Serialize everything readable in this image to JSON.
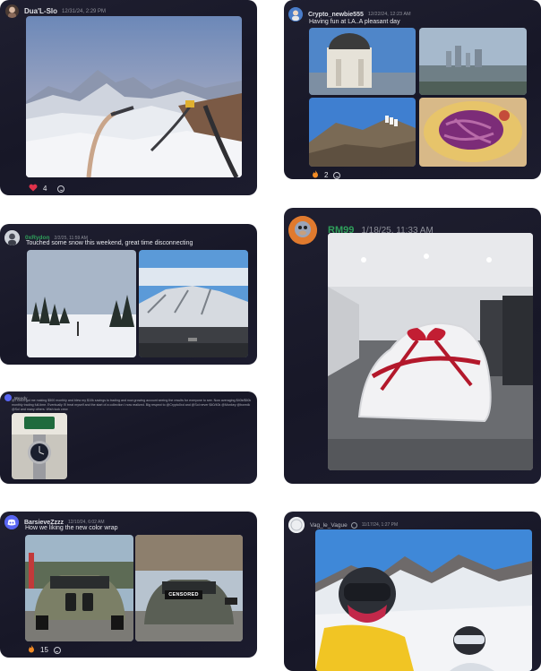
{
  "posts": [
    {
      "username": "Dua'L-Slo",
      "timestamp": "12/31/24, 2:29 PM",
      "heart_count": "4"
    },
    {
      "username": "Crypto_newbie555",
      "timestamp": "12/22/24, 12:23 AM",
      "message": "Having fun at LA..A pleasant day",
      "reaction_count": "2"
    },
    {
      "username": "0xRydon",
      "timestamp": "2/2/25, 11:59 AM",
      "message": "Touched some snow this weekend, great time disconnecting"
    },
    {
      "username": "RM99",
      "timestamp": "1/18/25, 11:33 AM"
    },
    {
      "username": "Moody",
      "message_excerpt": "@Tr3nch got me making $500 monthly and blew my $10k savings to trading and now growing account seeing the results for everyone to see. Now averaging $40k/$50k monthly trading full-time. Eventually I'll treat myself and the start of a collection I now realized. Big respect to @Crypto0xd and @Sol never $40/40k @Monkey @boredk @Sol and many others. Wish luck crew"
    },
    {
      "username": "BarsieveZzzz",
      "timestamp": "12/10/24, 6:02 AM",
      "message": "How we liking the new color wrap",
      "reaction_count": "15",
      "censor_label": "CENSORED"
    },
    {
      "username": "Vag_le_Vague",
      "timestamp": "11/17/24, 1:27 PM"
    }
  ],
  "colors": {
    "card_bg": "#1b1b2b",
    "username_default": "#dfe0e6",
    "username_green": "#2f9e5a",
    "timestamp": "#8e909a"
  }
}
